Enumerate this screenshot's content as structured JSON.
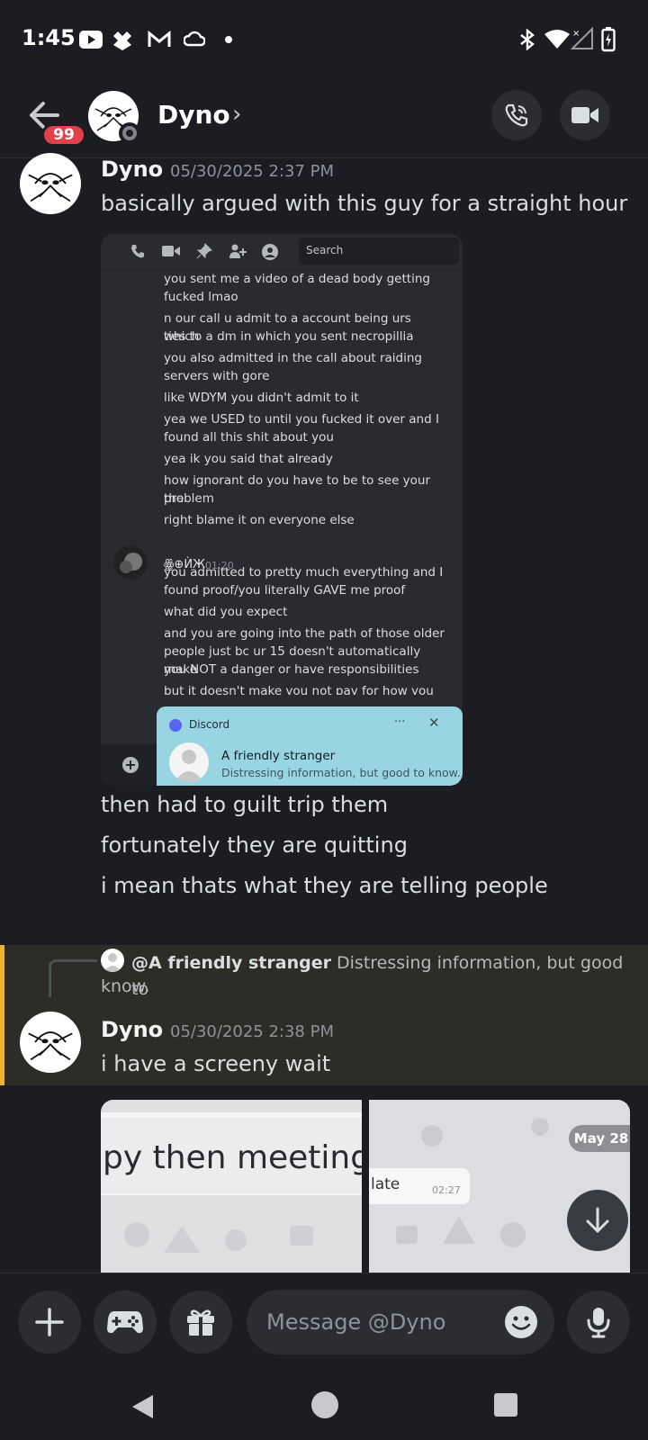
{
  "status": {
    "time": "1:45"
  },
  "header": {
    "notif_count": "99",
    "name": "Dyno"
  },
  "messages": [
    {
      "author": "Dyno",
      "timestamp": "05/30/2025 2:37 PM",
      "lines": [
        "basically argued with this guy for a straight hour",
        "then had to guilt trip them",
        "fortunately they are quitting",
        "i mean thats what they are telling people"
      ]
    },
    {
      "author": "Dyno",
      "timestamp": "05/30/2025 2:38 PM",
      "lines": [
        "i have a screeny wait"
      ]
    }
  ],
  "reply": {
    "mention": "@A friendly stranger",
    "text_line1": "Distressing information, but good to",
    "text_line2": "know."
  },
  "screenshot1": {
    "search_placeholder": "Search",
    "lines": [
      "you sent me a video of a dead body getting",
      "fucked lmao",
      "n our call u admit to a account being urs which",
      "ties to a dm in which you sent necropillia",
      "you also admitted in the call about raiding",
      "servers with gore",
      "like WDYM you didn't admit to it",
      "yea we USED to until you fucked it over and I",
      "found all this shit about you",
      "yea ik you said that already",
      "how ignorant do you have to be to see your the",
      "problem",
      "right blame it on everyone else"
    ],
    "second_author": "ꙮ⊕ЍЖ",
    "second_time": "01:20",
    "second_lines": [
      "you admitted to pretty much everything and I",
      "found proof/you literally GAVE me proof",
      "what did you expect",
      "and you are going into the path of those older",
      "people just bc ur 15 doesn't automatically make",
      "you NOT a danger or have responsibilities",
      "but it doesn't make you not pay for how you"
    ],
    "notification": {
      "app": "Discord",
      "title": "A friendly stranger",
      "body": "Distressing information, but good to know."
    }
  },
  "image_left": {
    "text": "py then meeting"
  },
  "image_right": {
    "date_badge": "May 28",
    "text": "late",
    "time": "02:27"
  },
  "input": {
    "placeholder": "Message @Dyno"
  }
}
